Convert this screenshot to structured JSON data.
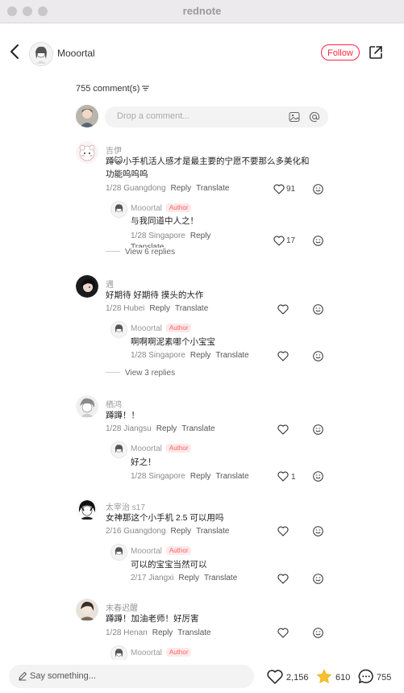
{
  "window": {
    "title": "rednote"
  },
  "header": {
    "author_name": "Mooortal",
    "follow_label": "Follow"
  },
  "comments_header": {
    "count_label": "755 comment(s)"
  },
  "composer": {
    "placeholder": "Drop a comment..."
  },
  "comments": [
    {
      "user": "吉伊",
      "text_line1": "蹲😺小手机活人感才是最主要的宁愿不要那么多美化和",
      "text_line2": "功能呜呜呜",
      "date_location": "1/28 Guangdong",
      "reply": "Reply",
      "translate": "Translate",
      "likes": "91",
      "sub": {
        "user": "Mooortal",
        "badge": "Author",
        "text": "与我同道中人之！",
        "date_location": "1/28 Singapore",
        "reply": "Reply",
        "translate": "Translate",
        "likes": "17"
      },
      "view_replies": "View 6 replies"
    },
    {
      "user": "遇",
      "text_line1": "好期待 好期待 摸头的大作",
      "date_location": "1/28 Hubei",
      "reply": "Reply",
      "translate": "Translate",
      "sub": {
        "user": "Mooortal",
        "badge": "Author",
        "text": "啊啊啊泥素哪个小宝宝",
        "date_location": "1/28 Singapore",
        "reply": "Reply",
        "translate": "Translate"
      },
      "view_replies": "View 3 replies"
    },
    {
      "user": "栖鸿",
      "text_line1": "蹲蹲！！",
      "date_location": "1/28 Jiangsu",
      "reply": "Reply",
      "translate": "Translate",
      "sub": {
        "user": "Mooortal",
        "badge": "Author",
        "text": "好之！",
        "date_location": "1/28 Singapore",
        "reply": "Reply",
        "translate": "Translate",
        "likes": "1"
      }
    },
    {
      "user": "太宰治 s17",
      "text_line1": "女神那这个小手机 2.5 可以用吗",
      "date_location": "2/16 Guangdong",
      "reply": "Reply",
      "translate": "Translate",
      "sub": {
        "user": "Mooortal",
        "badge": "Author",
        "text": "可以的宝宝当然可以",
        "date_location": "2/17 Jiangxi",
        "reply": "Reply",
        "translate": "Translate"
      }
    },
    {
      "user": "末春迟醒",
      "text_line1": "蹲蹲！加油老师！好厉害",
      "date_location": "1/28 Henan",
      "reply": "Reply",
      "translate": "Translate",
      "sub": {
        "user": "Mooortal",
        "badge": "Author"
      }
    }
  ],
  "bottom_bar": {
    "say_placeholder": "Say something...",
    "likes": "2,156",
    "collects": "610",
    "comments": "755"
  },
  "colors": {
    "accent": "#ff2442",
    "star": "#f5c12c"
  }
}
